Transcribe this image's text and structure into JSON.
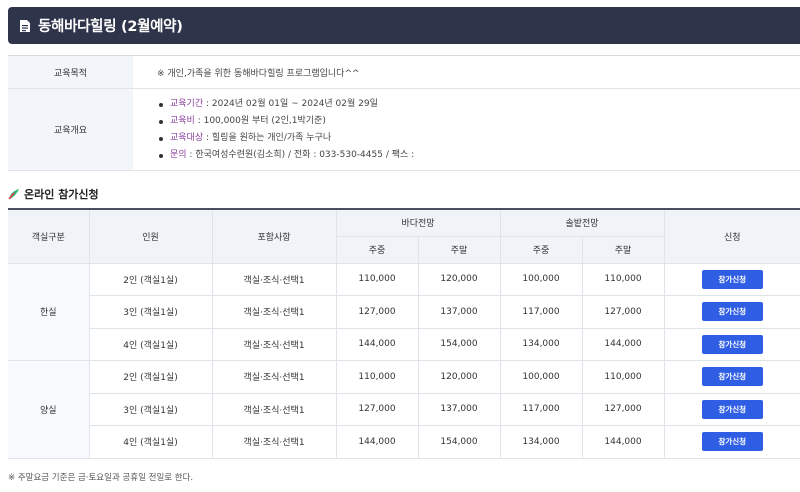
{
  "header": {
    "title": "동해바다힐링 (2월예약)"
  },
  "info": {
    "purpose_label": "교육목적",
    "purpose_value": "※ 개인,가족을 위한 동해바다힐링 프로그램입니다^^",
    "overview_label": "교육개요",
    "overview_items": [
      {
        "key": "교육기간",
        "value": " : 2024년 02월 01일 ~ 2024년 02월 29일"
      },
      {
        "key": "교육비",
        "value": " : 100,000원 부터 (2인,1박기준)"
      },
      {
        "key": "교육대상",
        "value": " : 힐링을 원하는 개인/가족 누구나"
      },
      {
        "key": "문의",
        "value": " : 한국여성수련원(김소희) / 전화 : 033-530-4455 / 팩스 :"
      }
    ]
  },
  "section": {
    "title": "온라인 참가신청"
  },
  "table": {
    "headers": {
      "room_type": "객실구분",
      "people": "인원",
      "includes": "포함사항",
      "sea_view": "바다전망",
      "mountain_view": "솔밭전망",
      "weekday": "주중",
      "weekend": "주말",
      "apply": "신청"
    },
    "groups": [
      {
        "room": "한실",
        "rows": [
          {
            "people": "2인 (객실1실)",
            "includes": "객실·조식·선택1",
            "sea_weekday": "110,000",
            "sea_weekend": "120,000",
            "mt_weekday": "100,000",
            "mt_weekend": "110,000",
            "button": "참가신청"
          },
          {
            "people": "3인 (객실1실)",
            "includes": "객실·조식·선택1",
            "sea_weekday": "127,000",
            "sea_weekend": "137,000",
            "mt_weekday": "117,000",
            "mt_weekend": "127,000",
            "button": "참가신청"
          },
          {
            "people": "4인 (객실1실)",
            "includes": "객실·조식·선택1",
            "sea_weekday": "144,000",
            "sea_weekend": "154,000",
            "mt_weekday": "134,000",
            "mt_weekend": "144,000",
            "button": "참가신청"
          }
        ]
      },
      {
        "room": "양실",
        "rows": [
          {
            "people": "2인 (객실1실)",
            "includes": "객실·조식·선택1",
            "sea_weekday": "110,000",
            "sea_weekend": "120,000",
            "mt_weekday": "100,000",
            "mt_weekend": "110,000",
            "button": "참가신청"
          },
          {
            "people": "3인 (객실1실)",
            "includes": "객실·조식·선택1",
            "sea_weekday": "127,000",
            "sea_weekend": "137,000",
            "mt_weekday": "117,000",
            "mt_weekend": "127,000",
            "button": "참가신청"
          },
          {
            "people": "4인 (객실1실)",
            "includes": "객실·조식·선택1",
            "sea_weekday": "144,000",
            "sea_weekend": "154,000",
            "mt_weekday": "134,000",
            "mt_weekend": "144,000",
            "button": "참가신청"
          }
        ]
      }
    ]
  },
  "footnote": "※ 주말요금 기준은 금·토요일과 공휴일 전일로 한다.",
  "colors": {
    "title_bg": "#2e3449",
    "button": "#2f5ee5",
    "overview_key": "#8a3e9e",
    "label_bg": "#f2f5fa"
  }
}
